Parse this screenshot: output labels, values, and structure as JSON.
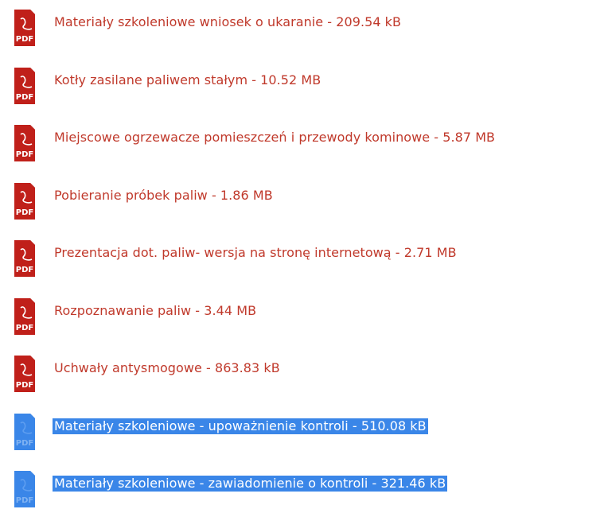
{
  "colors": {
    "link": "#c0392b",
    "pdf_icon": "#c0201a",
    "selection": "#3a86e8",
    "selection_text": "#ffffff"
  },
  "icon": {
    "name": "pdf-file-icon",
    "label": "PDF"
  },
  "files": [
    {
      "label": "Materiały szkoleniowe wniosek o ukaranie - 209.54 kB",
      "selected": false
    },
    {
      "label": "Kotły zasilane paliwem stałym - 10.52 MB",
      "selected": false
    },
    {
      "label": "Miejscowe ogrzewacze pomieszczeń i przewody kominowe - 5.87 MB",
      "selected": false
    },
    {
      "label": "Pobieranie próbek paliw - 1.86 MB",
      "selected": false
    },
    {
      "label": "Prezentacja dot. paliw- wersja na stronę internetową - 2.71 MB",
      "selected": false
    },
    {
      "label": "Rozpoznawanie paliw - 3.44 MB",
      "selected": false
    },
    {
      "label": "Uchwały antysmogowe - 863.83 kB",
      "selected": false
    },
    {
      "label": "Materiały szkoleniowe - upoważnienie kontroli - 510.08 kB",
      "selected": true
    },
    {
      "label": "Materiały szkoleniowe - zawiadomienie o kontroli - 321.46 kB",
      "selected": true
    }
  ]
}
